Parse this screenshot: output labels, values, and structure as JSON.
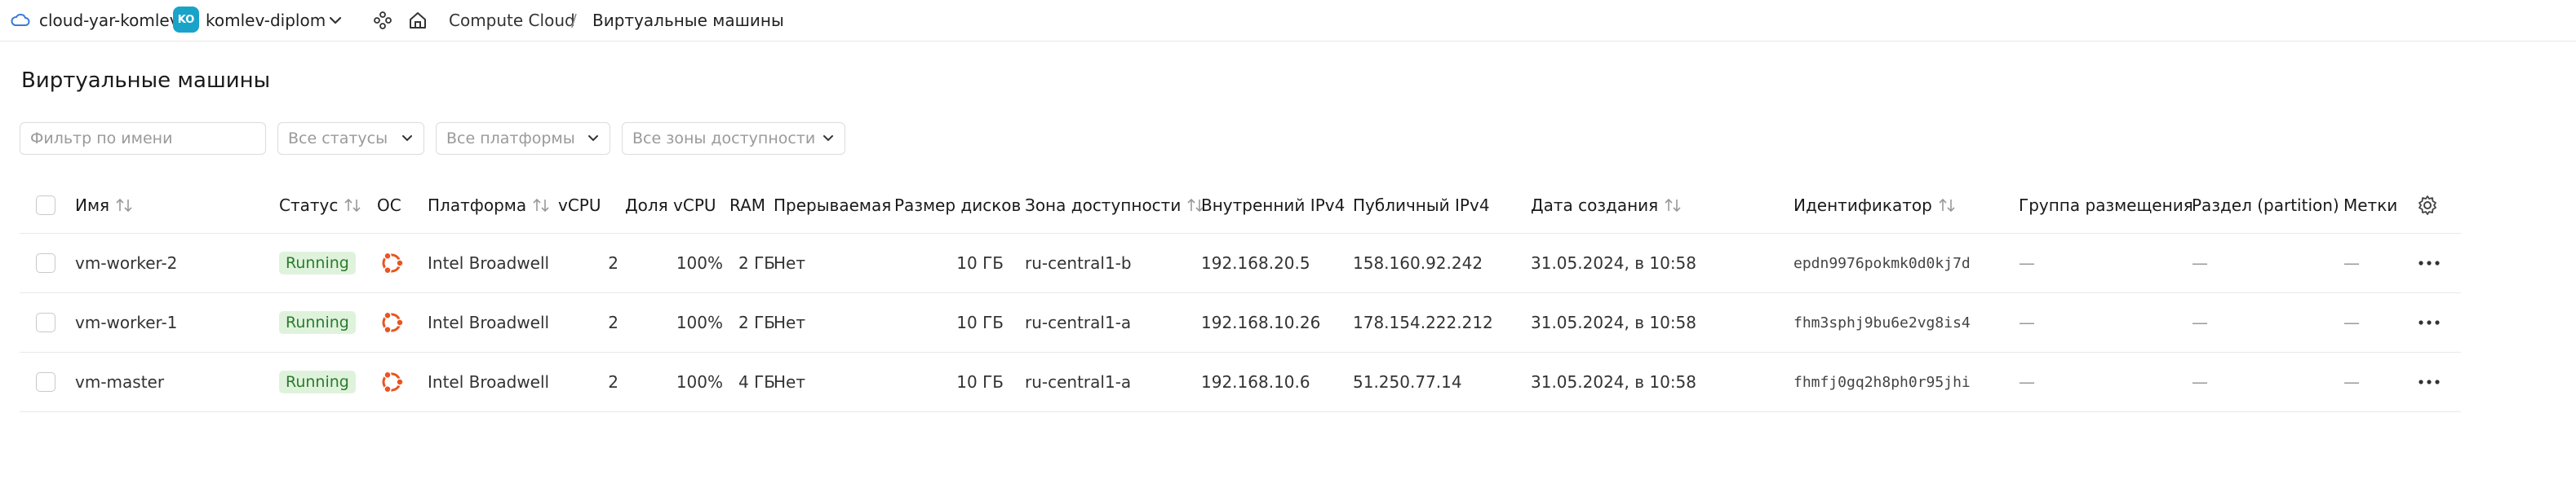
{
  "topbar": {
    "cloud_name": "cloud-yar-komlev",
    "folder_badge": "KO",
    "folder_name": "komlev-diplom",
    "breadcrumb": {
      "service": "Compute Cloud",
      "separator": "/",
      "page": "Виртуальные машины"
    }
  },
  "page": {
    "title": "Виртуальные машины"
  },
  "filters": {
    "name_placeholder": "Фильтр по имени",
    "status": "Все статусы",
    "platform": "Все платформы",
    "zone": "Все зоны доступности"
  },
  "table": {
    "columns": {
      "name": "Имя",
      "status": "Статус",
      "os": "ОС",
      "platform": "Платформа",
      "vcpu": "vCPU",
      "vcpu_share": "Доля vCPU",
      "ram": "RAM",
      "preemptible": "Прерываемая",
      "disk_size": "Размер дисков",
      "zone": "Зона доступности",
      "ipv4_internal": "Внутренний IPv4",
      "ipv4_public": "Публичный IPv4",
      "created": "Дата создания",
      "id": "Идентификатор",
      "placement_group": "Группа размещения",
      "partition": "Раздел (partition)",
      "labels": "Метки"
    },
    "rows": [
      {
        "name": "vm-worker-2",
        "status": "Running",
        "os_icon": "ubuntu-icon",
        "platform": "Intel Broadwell",
        "vcpu": "2",
        "vcpu_share": "100%",
        "ram": "2 ГБ",
        "preemptible": "Нет",
        "disk_size": "10 ГБ",
        "zone": "ru-central1-b",
        "ipv4_internal": "192.168.20.5",
        "ipv4_public": "158.160.92.242",
        "created": "31.05.2024, в 10:58",
        "id": "epdn9976pokmk0d0kj7d",
        "placement_group": "—",
        "partition": "—",
        "labels": "—"
      },
      {
        "name": "vm-worker-1",
        "status": "Running",
        "os_icon": "ubuntu-icon",
        "platform": "Intel Broadwell",
        "vcpu": "2",
        "vcpu_share": "100%",
        "ram": "2 ГБ",
        "preemptible": "Нет",
        "disk_size": "10 ГБ",
        "zone": "ru-central1-a",
        "ipv4_internal": "192.168.10.26",
        "ipv4_public": "178.154.222.212",
        "created": "31.05.2024, в 10:58",
        "id": "fhm3sphj9bu6e2vg8is4",
        "placement_group": "—",
        "partition": "—",
        "labels": "—"
      },
      {
        "name": "vm-master",
        "status": "Running",
        "os_icon": "ubuntu-icon",
        "platform": "Intel Broadwell",
        "vcpu": "2",
        "vcpu_share": "100%",
        "ram": "4 ГБ",
        "preemptible": "Нет",
        "disk_size": "10 ГБ",
        "zone": "ru-central1-a",
        "ipv4_internal": "192.168.10.6",
        "ipv4_public": "51.250.77.14",
        "created": "31.05.2024, в 10:58",
        "id": "fhmfj0gq2h8ph0r95jhi",
        "placement_group": "—",
        "partition": "—",
        "labels": "—"
      }
    ]
  },
  "colors": {
    "accent": "#19a3c9",
    "status_bg": "#dff3dc",
    "status_text": "#2c7a2e",
    "ubuntu": "#e95420"
  },
  "icons": [
    "cloud-icon",
    "chevron-down-icon",
    "services-icon",
    "home-icon",
    "sort-icon",
    "ubuntu-icon",
    "more-icon",
    "gear-icon"
  ]
}
